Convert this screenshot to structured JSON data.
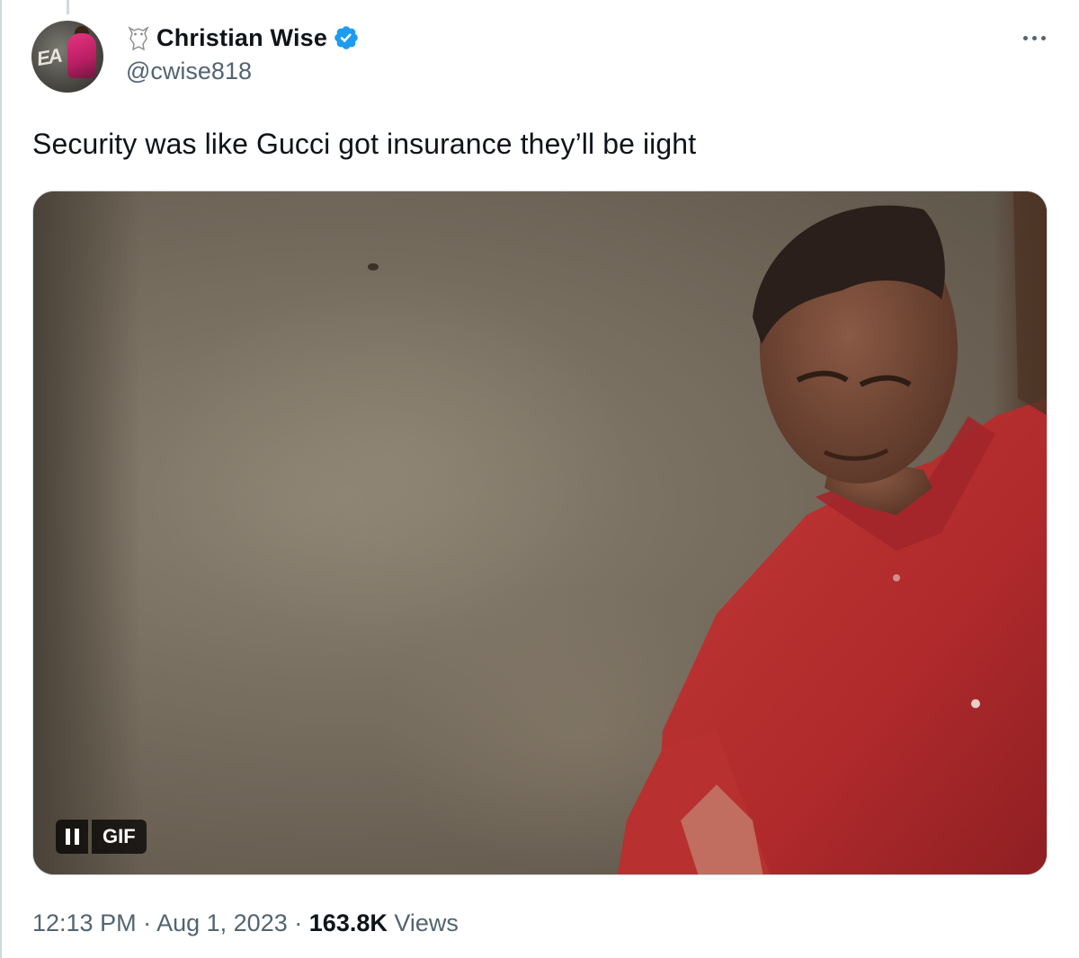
{
  "tweet": {
    "author": {
      "display_name": "Christian Wise",
      "handle": "@cwise818",
      "name_prefix_icon": "owl-icon",
      "verified": true,
      "verified_color": "#1d9bf0"
    },
    "text": "Security was like Gucci got insurance they’ll be iight",
    "media": {
      "type": "gif",
      "badge_label": "GIF",
      "paused_control_icon": "pause-icon"
    },
    "time": "12:13 PM",
    "separator": "·",
    "date": "Aug 1, 2023",
    "views_count": "163.8K",
    "views_label": "Views"
  },
  "colors": {
    "text_primary": "#0f1419",
    "text_secondary": "#536471",
    "border": "#cfd9de"
  }
}
